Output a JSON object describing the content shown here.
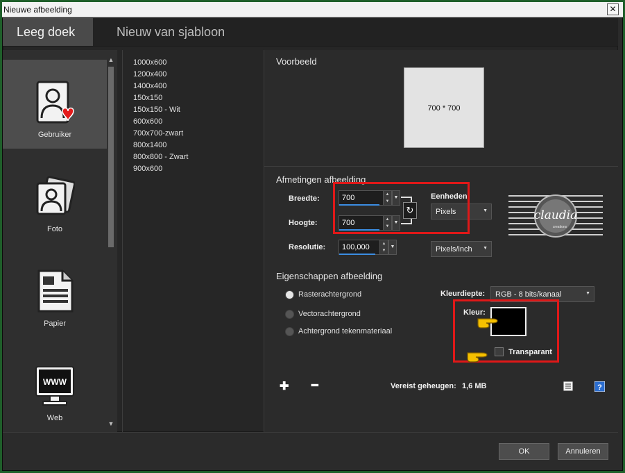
{
  "window": {
    "title": "Nieuwe afbeelding",
    "close": "✕"
  },
  "tabs": [
    {
      "label": "Leeg doek"
    },
    {
      "label": "Nieuw van sjabloon"
    }
  ],
  "categories": [
    {
      "label": "Gebruiker",
      "icon": "user-icon"
    },
    {
      "label": "Foto",
      "icon": "photo-icon"
    },
    {
      "label": "Papier",
      "icon": "paper-icon"
    },
    {
      "label": "Web",
      "icon": "web-icon"
    }
  ],
  "templates": [
    "1000x600",
    "1200x400",
    "1400x400",
    "150x150",
    "150x150 - Wit",
    "600x600",
    "700x700-zwart",
    "800x1400",
    "800x800 - Zwart",
    "900x600"
  ],
  "preview": {
    "title": "Voorbeeld",
    "text": "700 * 700"
  },
  "dimensions": {
    "title": "Afmetingen afbeelding",
    "width_label": "Breedte:",
    "width_value": "700",
    "height_label": "Hoogte:",
    "height_value": "700",
    "resolution_label": "Resolutie:",
    "resolution_value": "100,000",
    "units_label": "Eenheden:",
    "units_value": "Pixels",
    "res_units_value": "Pixels/inch"
  },
  "properties": {
    "title": "Eigenschappen afbeelding",
    "options": [
      "Rasterachtergrond",
      "Vectorachtergrond",
      "Achtergrond tekenmateriaal"
    ],
    "selected_option": "Rasterachtergrond",
    "depth_label": "Kleurdiepte:",
    "depth_value": "RGB - 8 bits/kanaal",
    "color_label": "Kleur:",
    "color_value": "#000000",
    "transparent_label": "Transparant",
    "transparent_checked": false
  },
  "footer": {
    "memory_label": "Vereist geheugen:",
    "memory_value": "1,6 MB",
    "ok": "OK",
    "cancel": "Annuleren"
  },
  "watermark": {
    "text": "claudia",
    "subtext": "creations"
  },
  "colors": {
    "accent_blue": "#3b8de2",
    "highlight_red": "#e01818",
    "frame_green": "#1f5f2a"
  }
}
